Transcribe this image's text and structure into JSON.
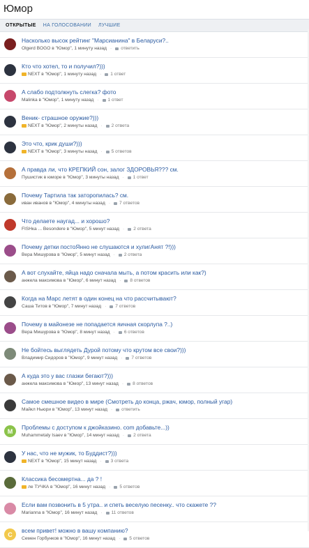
{
  "title": "Юмор",
  "tabs": [
    {
      "label": "ОТКРЫТЫЕ"
    },
    {
      "label": "НА ГОЛОСОВАНИИ"
    },
    {
      "label": "ЛУЧШИЕ"
    }
  ],
  "items": [
    {
      "question": "Насколько высок рейтинг \"Марсианина\" в Беларуси?..",
      "author": "Olgerd BOGO в \"Юмор\", 1 минуту назад",
      "answers": "ответить",
      "avatar_color": "#7a1f1f",
      "medal": false
    },
    {
      "question": "Кто что хотел, то и получил?)))",
      "author": "NEXT в \"Юмор\", 1 минуту назад",
      "answers": "1 ответ",
      "avatar_color": "#2d3340",
      "medal": true
    },
    {
      "question": "А слабо подтолкнуть слегка? фото",
      "author": "Malinka в \"Юмор\", 1 минуту назад",
      "answers": "1 ответ",
      "avatar_color": "#c7486b",
      "medal": false
    },
    {
      "question": "Веник- страшное оружие?)))",
      "author": "NEXT в \"Юмор\", 2 минуты назад",
      "answers": "2 ответа",
      "avatar_color": "#2d3340",
      "medal": true
    },
    {
      "question": "Это что, крик души?)))",
      "author": "NEXT в \"Юмор\", 3 минуты назад",
      "answers": "5 ответов",
      "avatar_color": "#2d3340",
      "medal": true
    },
    {
      "question": "А правда ли, что КРЕПКИЙ сон, залог ЗДОРОВЬЯ??? см.",
      "author": "Пушистик в юморе в \"Юмор\", 3 минуты назад",
      "answers": "1 ответ",
      "avatar_color": "#b5703a",
      "medal": false
    },
    {
      "question": "Почему Тартила так заторопилась? см.",
      "author": "иван иванов в \"Юмор\", 4 минуты назад",
      "answers": "7 ответов",
      "avatar_color": "#8a6b3b",
      "medal": false
    },
    {
      "question": "Что делаете наугад... и хорошо?",
      "author": "FISHка ... Besondere в \"Юмор\", 5 минут назад",
      "answers": "2 ответа",
      "avatar_color": "#c0392b",
      "medal": false
    },
    {
      "question": "Почему детки постоЯнно не слушаются и хулигАнят ?!)))",
      "author": "Вера Мишурова в \"Юмор\", 5 минут назад",
      "answers": "2 ответа",
      "avatar_color": "#9b4d8a",
      "medal": false
    },
    {
      "question": "А вот слухайте, яйца надо сначала мыть, а потом красить или как?)",
      "author": "анжела максимова в \"Юмор\", 6 минут назад",
      "answers": "8 ответов",
      "avatar_color": "#6b5a4a",
      "medal": false
    },
    {
      "question": "Когда на Марс летят в один конец на что рассчитывают?",
      "author": "Саша Титов в \"Юмор\", 7 минут назад",
      "answers": "7 ответов",
      "avatar_color": "#444444",
      "medal": false
    },
    {
      "question": "Почему в майонезе не попадается яичная скорлупа ?..)",
      "author": "Вера Мишурова в \"Юмор\", 8 минут назад",
      "answers": "6 ответов",
      "avatar_color": "#9b4d8a",
      "medal": false
    },
    {
      "question": "Не бойтесь выглядеть Дурой потому что крутом все свои?)))",
      "author": "Владимир Сидоров в \"Юмор\", 9 минут назад",
      "answers": "7 ответов",
      "avatar_color": "#7d8a78",
      "medal": false
    },
    {
      "question": "А куда это у вас глазки бегают?)))",
      "author": "анжела максимова в \"Юмор\", 13 минут назад",
      "answers": "8 ответов",
      "avatar_color": "#6b5a4a",
      "medal": false
    },
    {
      "question": "Самое смешное видео в мире (Смотреть до конца, ржач, юмор, полный угар)",
      "author": "Майкл Ньюри в \"Юмор\", 13 минут назад",
      "answers": "ответить",
      "avatar_color": "#3a3a3a",
      "medal": false
    },
    {
      "question": "Проблемы с доступом к джойказино. com добавьте...))",
      "author": "Muhammetaly Isaev в \"Юмор\", 14 минут назад",
      "answers": "2 ответа",
      "avatar_color": "#8bc34a",
      "avatar_letter": "M",
      "medal": false
    },
    {
      "question": "У нас, что не мужик, то Буддист?)))",
      "author": "NEXT в \"Юмор\", 15 минут назад",
      "answers": "3 ответа",
      "avatar_color": "#2d3340",
      "medal": true
    },
    {
      "question": "Классика бесомертна... да ? !",
      "author": "ле ТУЧКА в \"Юмор\", 16 минут назад",
      "answers": "5 ответов",
      "avatar_color": "#5a6b3a",
      "medal": true
    },
    {
      "question": "Если вам позвонить в 5 утра.. и спеть веселую песенку.. что скажете ??",
      "author": "Marianna в \"Юмор\", 16 минут назад",
      "answers": "11 ответов",
      "avatar_color": "#d98aa6",
      "medal": false
    },
    {
      "question": "всем привет! можно в вашу компанию?",
      "author": "Семен Горбунков в \"Юмор\", 16 минут назад",
      "answers": "5 ответов",
      "avatar_color": "#f2c94c",
      "avatar_letter": "С",
      "medal": false
    }
  ]
}
